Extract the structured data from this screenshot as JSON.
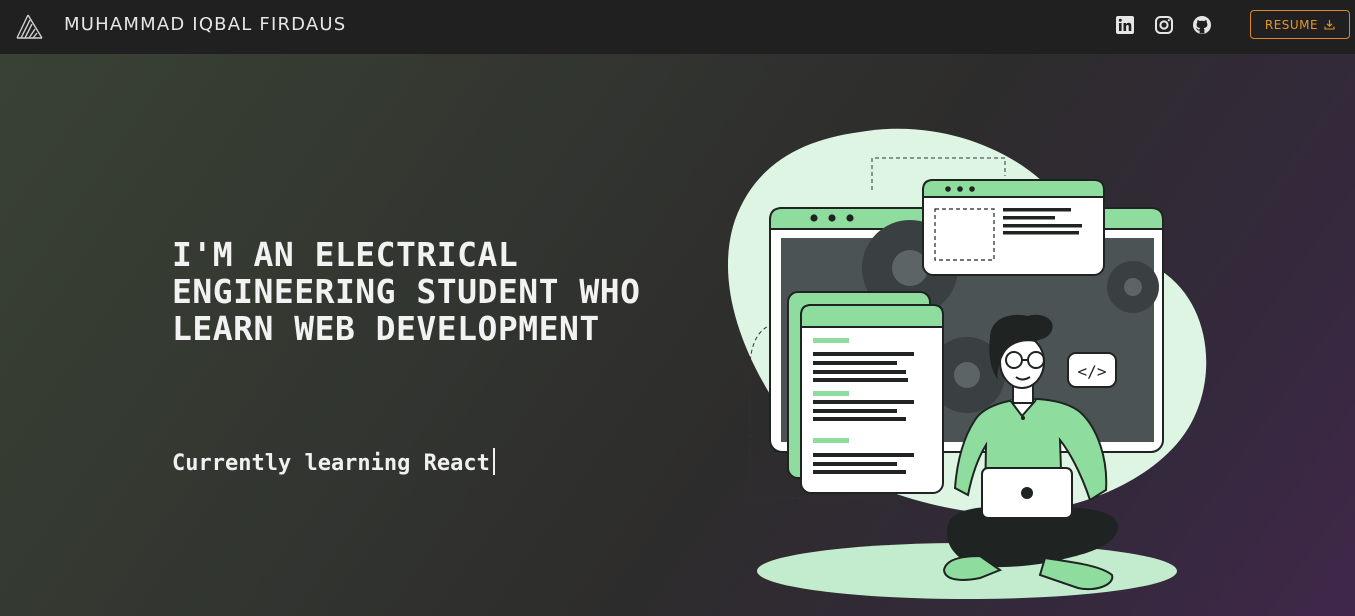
{
  "navbar": {
    "brand": "MUHAMMAD IQBAL FIRDAUS",
    "social_icons": [
      "linkedin-icon",
      "instagram-icon",
      "github-icon"
    ],
    "resume_label": "RESUME",
    "resume_icon": "download-icon"
  },
  "hero": {
    "headline_lines": [
      "I'M AN ELECTRICAL",
      "ENGINEERING STUDENT WHO",
      "LEARN WEB DEVELOPMENT"
    ],
    "typing_text": "Currently learning React",
    "illustration": "developer-with-laptop-illustration"
  },
  "colors": {
    "navbar_bg": "#202020",
    "accent": "#e8952d",
    "illustration_green": "#8fdc9f",
    "text": "#f2f2f2"
  }
}
